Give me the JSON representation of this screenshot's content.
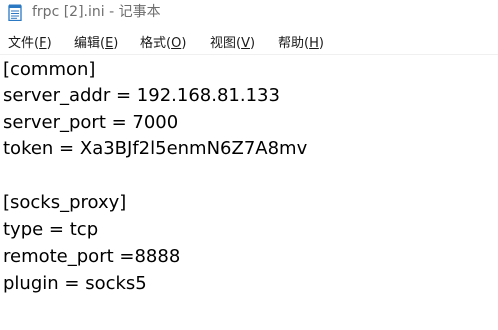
{
  "window": {
    "title": "frpc [2].ini - 记事本",
    "icon": "notepad-icon"
  },
  "menu": {
    "items": [
      {
        "label": "文件(",
        "mnemonic": "F",
        "close": ")"
      },
      {
        "label": "编辑(",
        "mnemonic": "E",
        "close": ")"
      },
      {
        "label": "格式(",
        "mnemonic": "O",
        "close": ")"
      },
      {
        "label": "视图(",
        "mnemonic": "V",
        "close": ")"
      },
      {
        "label": "帮助(",
        "mnemonic": "H",
        "close": ")"
      }
    ]
  },
  "document": {
    "lines": [
      "[common]",
      "server_addr = 192.168.81.133",
      "server_port = 7000",
      "token = Xa3BJf2l5enmN6Z7A8mv",
      "",
      "[socks_proxy]",
      "type = tcp",
      "remote_port =8888",
      "plugin = socks5"
    ]
  },
  "colors": {
    "title_text": "#6e6e6e",
    "menu_text": "#1a1a1a",
    "editor_text": "#000000",
    "background": "#ffffff",
    "icon_blue": "#2b79c2"
  }
}
